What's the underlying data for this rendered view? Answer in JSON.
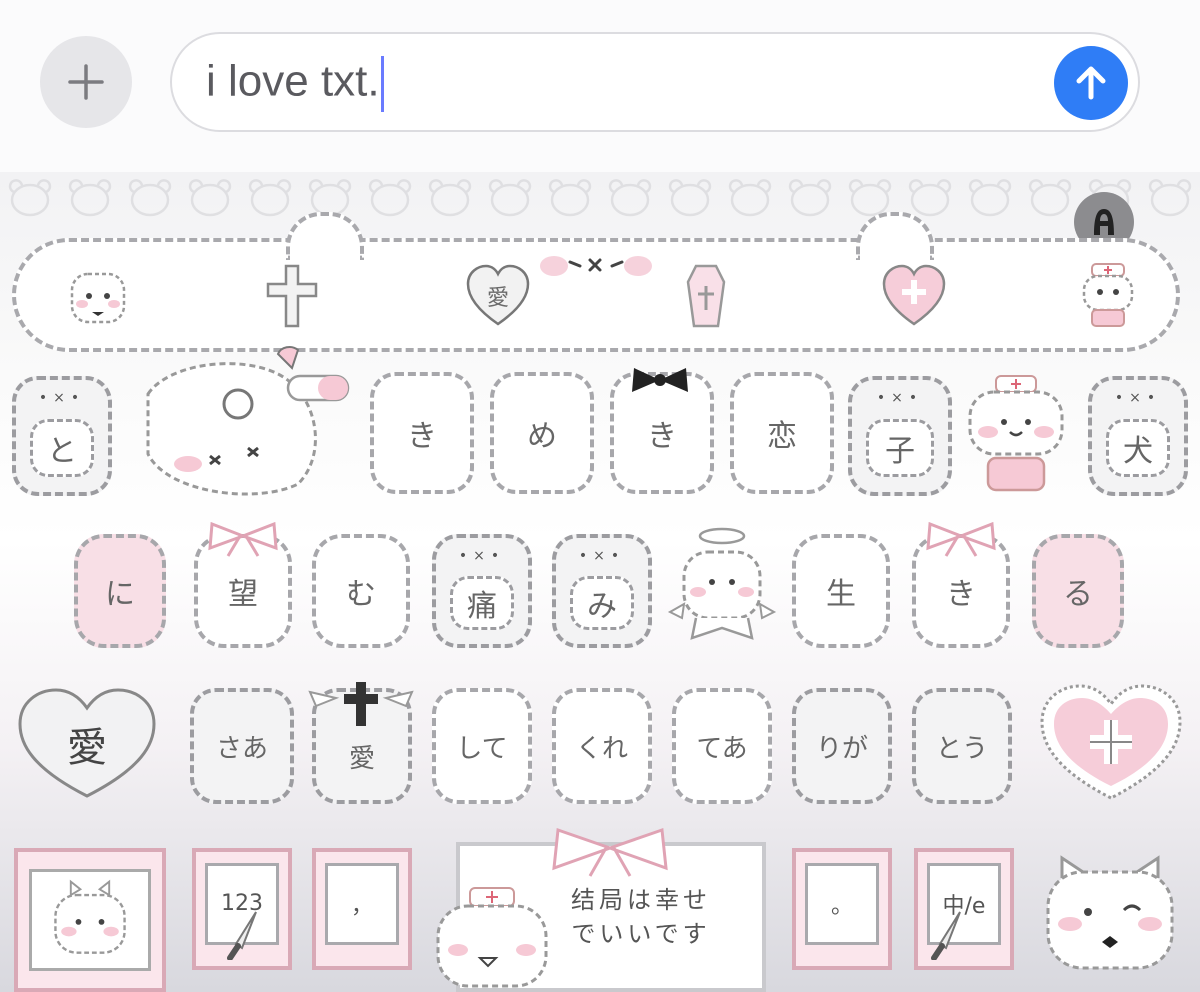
{
  "input_bar": {
    "plus_label": "+",
    "message_text": "i love txt.",
    "send_icon": "arrow-up-icon"
  },
  "colors": {
    "send": "#2f7df6",
    "key_pink": "#f8dfe6",
    "border_gray": "#a7a7ab"
  },
  "suggestion_bar": {
    "heart_text": "愛"
  },
  "keyboard": {
    "row1": [
      "と",
      "き",
      "め",
      "き",
      "恋",
      "子",
      "犬"
    ],
    "row2": [
      "に",
      "望",
      "む",
      "痛",
      "み",
      "生",
      "き",
      "る"
    ],
    "row3": [
      "愛",
      "さあ",
      "愛",
      "して",
      "くれ",
      "てあ",
      "りが",
      "とう"
    ],
    "row4": {
      "numbers": "123",
      "comma": "，",
      "space_line1": "结局は幸せ",
      "space_line2": "でいいです",
      "period": "。",
      "lang": "中/e"
    }
  }
}
